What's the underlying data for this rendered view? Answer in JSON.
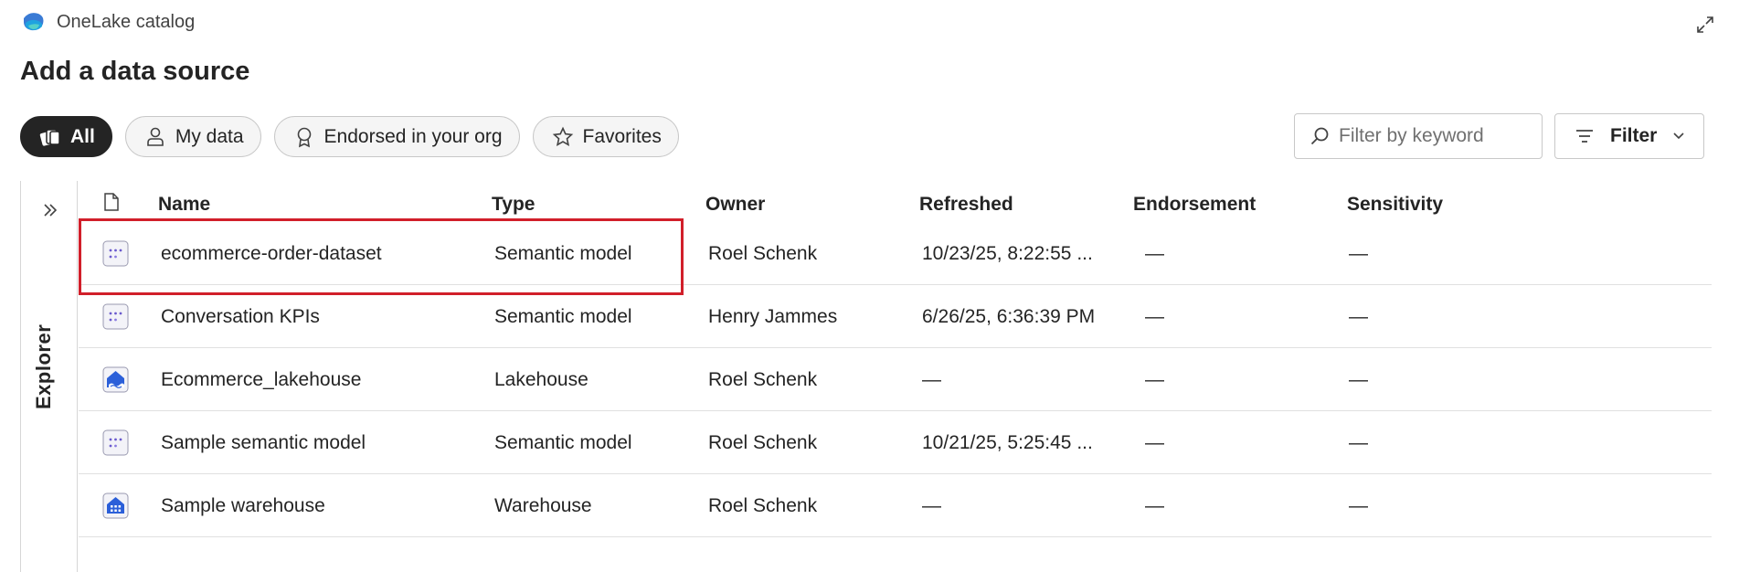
{
  "app": {
    "title": "OneLake catalog"
  },
  "page": {
    "title": "Add a data source"
  },
  "filters": {
    "pills": [
      {
        "label": "All",
        "icon": "stacked-items-icon",
        "active": true
      },
      {
        "label": "My data",
        "icon": "person-icon",
        "active": false
      },
      {
        "label": "Endorsed in your org",
        "icon": "ribbon-icon",
        "active": false
      },
      {
        "label": "Favorites",
        "icon": "star-icon",
        "active": false
      }
    ],
    "search_placeholder": "Filter by keyword",
    "filter_label": "Filter"
  },
  "explorer": {
    "label": "Explorer"
  },
  "table": {
    "columns": [
      "Name",
      "Type",
      "Owner",
      "Refreshed",
      "Endorsement",
      "Sensitivity"
    ],
    "rows": [
      {
        "icon": "semantic-model-icon",
        "name": "ecommerce-order-dataset",
        "type": "Semantic model",
        "owner": "Roel Schenk",
        "refreshed": "10/23/25, 8:22:55 ...",
        "endorsement": "—",
        "sensitivity": "—"
      },
      {
        "icon": "semantic-model-icon",
        "name": "Conversation KPIs",
        "type": "Semantic model",
        "owner": "Henry Jammes",
        "refreshed": "6/26/25, 6:36:39 PM",
        "endorsement": "—",
        "sensitivity": "—"
      },
      {
        "icon": "lakehouse-icon",
        "name": "Ecommerce_lakehouse",
        "type": "Lakehouse",
        "owner": "Roel Schenk",
        "refreshed": "—",
        "endorsement": "—",
        "sensitivity": "—"
      },
      {
        "icon": "semantic-model-icon",
        "name": "Sample semantic model",
        "type": "Semantic model",
        "owner": "Roel Schenk",
        "refreshed": "10/21/25, 5:25:45 ...",
        "endorsement": "—",
        "sensitivity": "—"
      },
      {
        "icon": "warehouse-icon",
        "name": "Sample warehouse",
        "type": "Warehouse",
        "owner": "Roel Schenk",
        "refreshed": "—",
        "endorsement": "—",
        "sensitivity": "—"
      }
    ]
  },
  "colors": {
    "highlight": "#d11f2a",
    "accent": "#2b5fd9",
    "active_pill": "#242424"
  }
}
